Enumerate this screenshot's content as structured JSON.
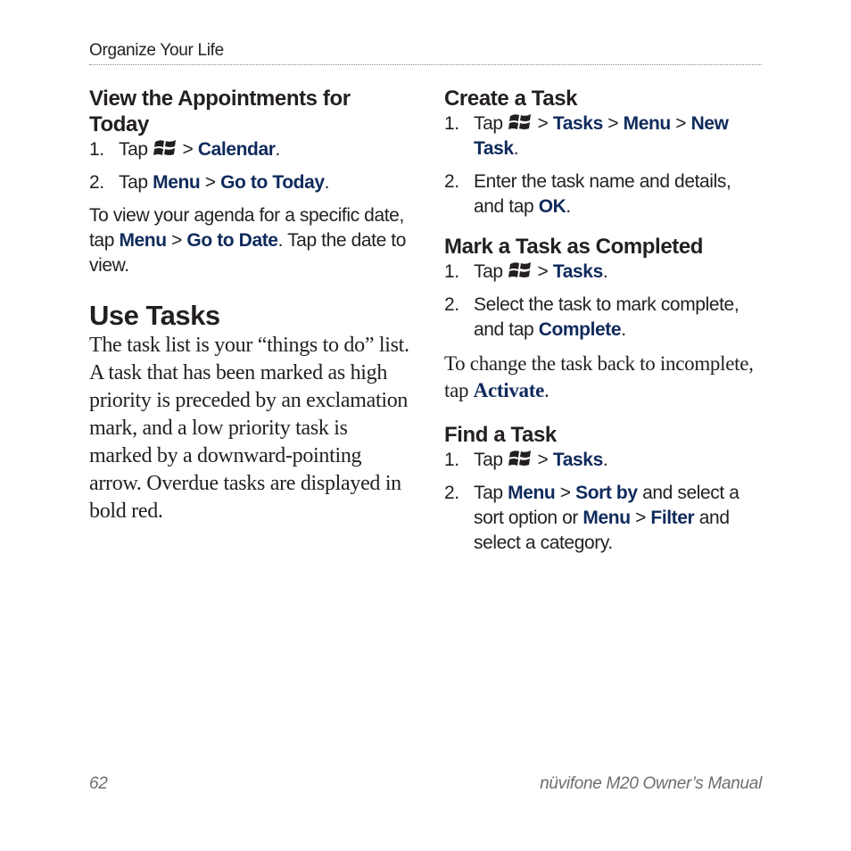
{
  "header": {
    "section_title": "Organize Your Life"
  },
  "left": {
    "appointments": {
      "heading": "View the Appointments for Today",
      "steps": [
        {
          "num": "1.",
          "pre": "Tap",
          "sep1": ">",
          "link1": "Calendar",
          "end": "."
        },
        {
          "num": "2.",
          "pre": "Tap",
          "link1": "Menu",
          "sep1": ">",
          "link2": "Go to Today",
          "end": "."
        }
      ],
      "note": {
        "pre": "To view your agenda for a specific date, tap",
        "link1": "Menu",
        "sep": ">",
        "link2": "Go to Date",
        "post": ". Tap the date to view."
      }
    },
    "use_tasks": {
      "heading": "Use Tasks",
      "body": "The task list is your “things to do” list. A task that has been marked as high priority is preceded by an exclamation mark, and a low priority task is marked by a downward-pointing arrow. Overdue tasks are displayed in bold red."
    }
  },
  "right": {
    "create": {
      "heading": "Create a Task",
      "steps": [
        {
          "num": "1.",
          "pre": "Tap",
          "sep1": ">",
          "link1": "Tasks",
          "sep2": ">",
          "link2": "Menu",
          "sep3": ">",
          "link3": "New Task",
          "end": "."
        },
        {
          "num": "2.",
          "pre": "Enter the task name and details, and tap",
          "link1": "OK",
          "end": "."
        }
      ]
    },
    "mark": {
      "heading": "Mark a Task as Completed",
      "steps": [
        {
          "num": "1.",
          "pre": "Tap",
          "sep1": ">",
          "link1": "Tasks",
          "end": "."
        },
        {
          "num": "2.",
          "pre": "Select the task to mark complete, and tap",
          "link1": "Complete",
          "end": "."
        }
      ],
      "note": {
        "pre": "To change the task back to incomplete, tap",
        "link1": "Activate",
        "end": "."
      }
    },
    "find": {
      "heading": "Find a Task",
      "steps": [
        {
          "num": "1.",
          "pre": "Tap",
          "sep1": ">",
          "link1": "Tasks",
          "end": "."
        },
        {
          "num": "2.",
          "pre": "Tap",
          "link1": "Menu",
          "sep1": ">",
          "link2": "Sort by",
          "mid": "and select a sort option or",
          "link3": "Menu",
          "sep2": ">",
          "link4": "Filter",
          "post": "and select a category."
        }
      ]
    }
  },
  "footer": {
    "page_number": "62",
    "manual_title": "nüvifone M20 Owner’s Manual"
  },
  "colors": {
    "ui_term": "#0f2a5c",
    "body_text": "#231f20",
    "footer_text": "#6d6e71"
  }
}
